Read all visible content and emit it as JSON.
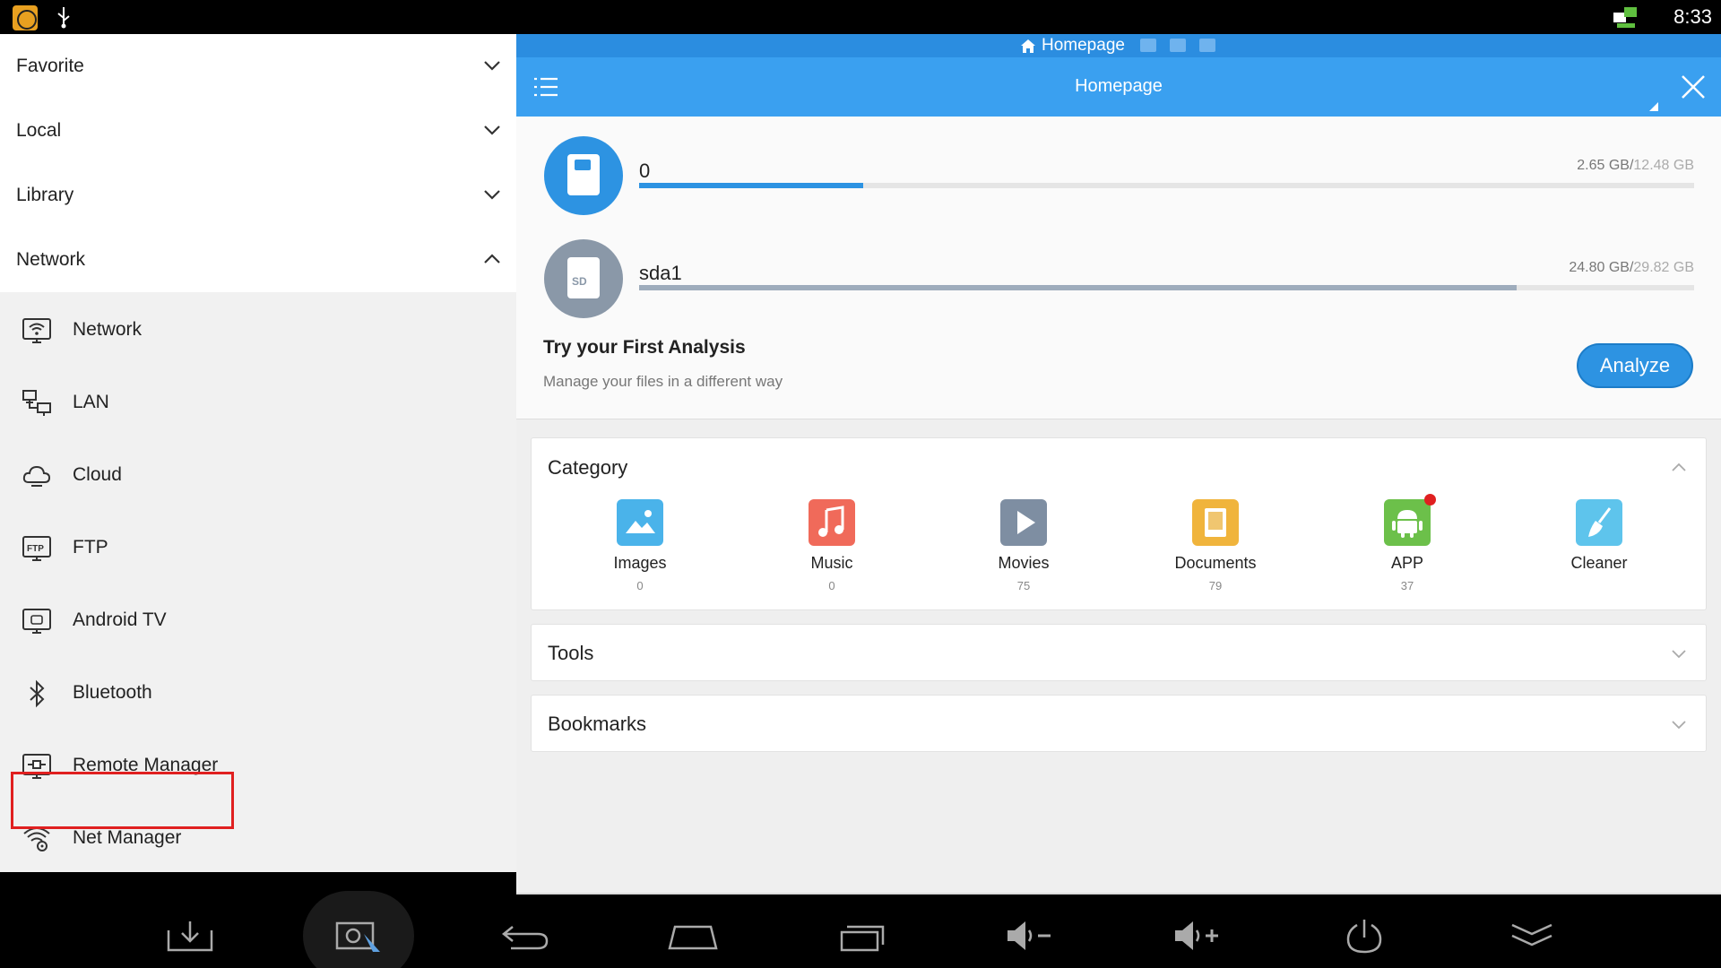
{
  "statusbar": {
    "time": "8:33"
  },
  "drawer": {
    "sections": [
      {
        "label": "Favorite",
        "expanded": false
      },
      {
        "label": "Local",
        "expanded": false
      },
      {
        "label": "Library",
        "expanded": false
      },
      {
        "label": "Network",
        "expanded": true
      }
    ],
    "network_items": [
      {
        "label": "Network",
        "icon": "wifi-monitor-icon"
      },
      {
        "label": "LAN",
        "icon": "lan-icon"
      },
      {
        "label": "Cloud",
        "icon": "cloud-icon"
      },
      {
        "label": "FTP",
        "icon": "ftp-icon"
      },
      {
        "label": "Android TV",
        "icon": "android-tv-icon"
      },
      {
        "label": "Bluetooth",
        "icon": "bluetooth-icon"
      },
      {
        "label": "Remote Manager",
        "icon": "remote-manager-icon"
      },
      {
        "label": "Net Manager",
        "icon": "net-manager-icon"
      }
    ]
  },
  "tabbar": {
    "tab_label": "Homepage"
  },
  "toolbar": {
    "title": "Homepage"
  },
  "storage": [
    {
      "name": "0",
      "used": "2.65 GB",
      "total": "12.48 GB",
      "used_fraction": 0.212
    },
    {
      "name": "sda1",
      "used": "24.80 GB",
      "total": "29.82 GB",
      "used_fraction": 0.832
    }
  ],
  "analysis": {
    "title": "Try your First Analysis",
    "subtitle": "Manage your files in a different way",
    "button": "Analyze"
  },
  "category": {
    "title": "Category",
    "items": [
      {
        "label": "Images",
        "count": "0",
        "color": "#4ab3ea",
        "icon": "images-icon"
      },
      {
        "label": "Music",
        "count": "0",
        "color": "#f06a5a",
        "icon": "music-icon"
      },
      {
        "label": "Movies",
        "count": "75",
        "color": "#7e8ea2",
        "icon": "movies-icon"
      },
      {
        "label": "Documents",
        "count": "79",
        "color": "#f0b43c",
        "icon": "documents-icon"
      },
      {
        "label": "APP",
        "count": "37",
        "color": "#6cc04a",
        "icon": "android-app-icon"
      },
      {
        "label": "Cleaner",
        "count": "",
        "color": "#5ec4ec",
        "icon": "cleaner-broom-icon"
      }
    ]
  },
  "tools": {
    "title": "Tools"
  },
  "bookmarks": {
    "title": "Bookmarks"
  },
  "colors": {
    "accent": "#3aa0f0",
    "highlight": "#e02020"
  }
}
